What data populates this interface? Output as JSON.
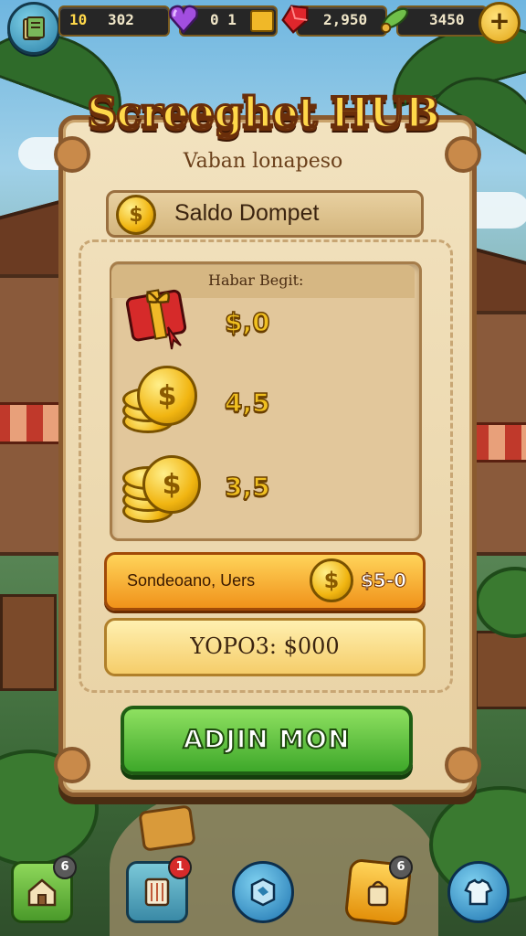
{
  "game": {
    "title": "Screeghet HUB",
    "subtitle": "Vaban lonapeso"
  },
  "resources": [
    {
      "icon": "book-icon",
      "value": "10",
      "secondary": "302"
    },
    {
      "icon": "purple-heart-gem-icon",
      "value": "0 1"
    },
    {
      "icon": "red-ruby-icon",
      "value": "2,950"
    },
    {
      "icon": "green-feather-icon",
      "value": "3450"
    }
  ],
  "wallet": {
    "label": "Saldo Dompet",
    "list_header": "Habar Begit:",
    "items": [
      {
        "icon": "red-gift-box-icon",
        "value": "$,0"
      },
      {
        "icon": "coin-stack-icon",
        "value": "4,5"
      },
      {
        "icon": "coin-stack-icon",
        "value": "3,5"
      }
    ]
  },
  "offer": {
    "label": "Sondeoano, Uers",
    "price": "$5-0"
  },
  "total": {
    "label": "YOPO3: $000"
  },
  "action": {
    "label": "ADJIN MON"
  },
  "nav": [
    {
      "icon": "home-icon",
      "badge": "6"
    },
    {
      "icon": "scroll-icon",
      "badge": "1"
    },
    {
      "icon": "map-icon",
      "badge": ""
    },
    {
      "icon": "bag-icon",
      "badge": "6"
    },
    {
      "icon": "shirt-icon",
      "badge": ""
    }
  ],
  "colors": {
    "accent_gold": "#ffd84a",
    "panel_bg": "#f2e2bf",
    "button_green": "#3ea82a",
    "button_orange": "#f0921a"
  }
}
